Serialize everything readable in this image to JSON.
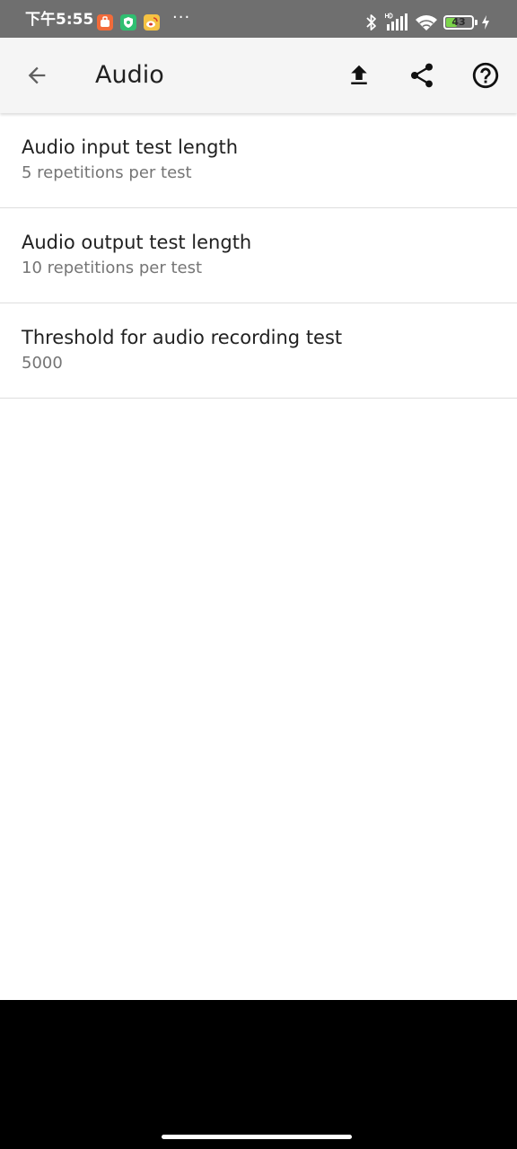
{
  "status_bar": {
    "time": "下午5:55",
    "more": "···",
    "battery_level": "43",
    "battery_fraction": 0.43,
    "icons": [
      "app-notification-icon",
      "shield-app-icon",
      "weibo-icon",
      "bluetooth-icon",
      "hd-signal-icon",
      "wifi-icon",
      "battery-icon",
      "charging-icon"
    ]
  },
  "app_bar": {
    "title": "Audio",
    "icons": [
      "back-arrow-icon",
      "upload-icon",
      "share-icon",
      "help-icon"
    ]
  },
  "settings": [
    {
      "title": "Audio input test length",
      "summary": "5 repetitions per test"
    },
    {
      "title": "Audio output test length",
      "summary": "10 repetitions per test"
    },
    {
      "title": "Threshold for audio recording test",
      "summary": "5000"
    }
  ],
  "colors": {
    "status_bar": "#6f6f6f",
    "app_bar": "#f5f5f5",
    "title_text": "#212121",
    "summary_text": "#757575",
    "divider": "#dedede",
    "battery_fill": "#7bd44a",
    "nav_bar": "#000000"
  }
}
